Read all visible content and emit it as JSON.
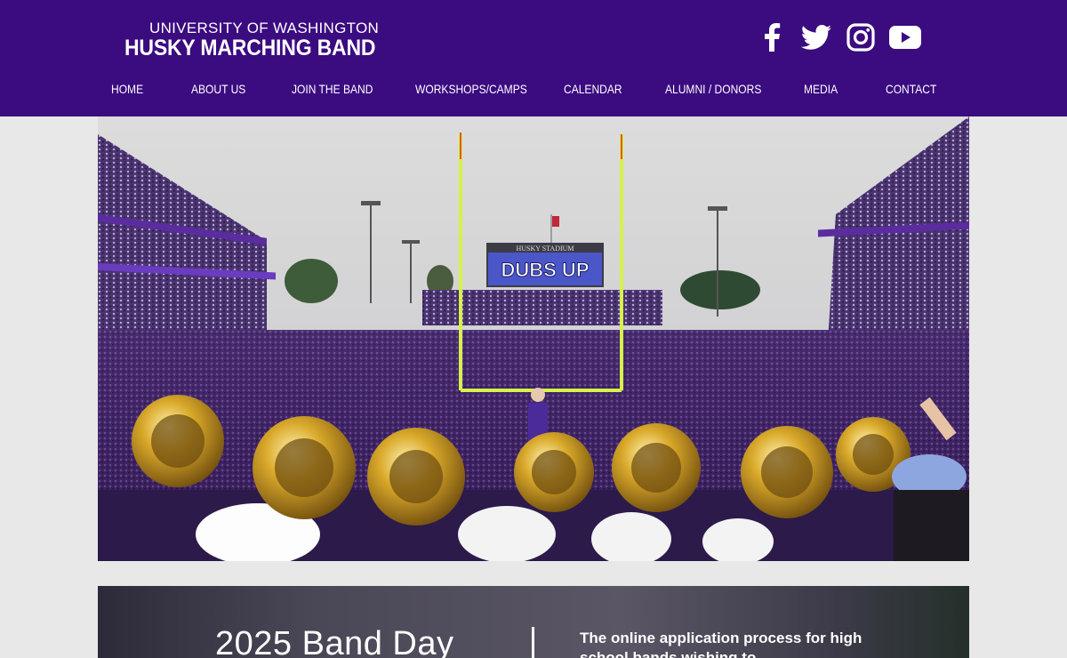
{
  "header": {
    "logo_top": "UNIVERSITY OF WASHINGTON",
    "logo_bottom": "HUSKY MARCHING BAND",
    "background": "#3b0b80"
  },
  "social": [
    {
      "icon": "facebook-icon"
    },
    {
      "icon": "twitter-icon"
    },
    {
      "icon": "instagram-icon"
    },
    {
      "icon": "youtube-icon"
    }
  ],
  "nav": [
    {
      "label": "HOME"
    },
    {
      "label": "ABOUT US"
    },
    {
      "label": "JOIN THE BAND"
    },
    {
      "label": "WORKSHOPS/CAMPS"
    },
    {
      "label": "CALENDAR"
    },
    {
      "label": "ALUMNI / DONORS"
    },
    {
      "label": "MEDIA"
    },
    {
      "label": "CONTACT"
    }
  ],
  "hero": {
    "scoreboard_top": "HUSKY STADIUM",
    "scoreboard_text": "DUBS UP"
  },
  "promo": {
    "title": "2025 Band Day",
    "text": "The online application process for high school bands wishing to"
  }
}
